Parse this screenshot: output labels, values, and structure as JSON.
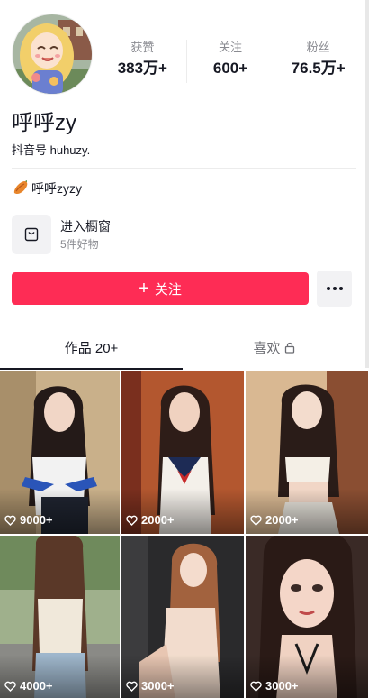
{
  "profile": {
    "nickname": "呼呼zy",
    "douyin_id": "抖音号 huhuzy.",
    "signature": "呼呼zyzy"
  },
  "stats": [
    {
      "label": "获赞",
      "value": "383万+"
    },
    {
      "label": "关注",
      "value": "600+"
    },
    {
      "label": "粉丝",
      "value": "76.5万+"
    }
  ],
  "shop": {
    "title": "进入橱窗",
    "subtitle": "5件好物"
  },
  "actions": {
    "follow_label": "关注"
  },
  "tabs": [
    {
      "label": "作品 20+",
      "active": true
    },
    {
      "label": "喜欢",
      "active": false,
      "icon": "lock-icon"
    }
  ],
  "videos": [
    {
      "likes": "9000+"
    },
    {
      "likes": "2000+"
    },
    {
      "likes": "2000+"
    },
    {
      "likes": "4000+"
    },
    {
      "likes": "3000+"
    },
    {
      "likes": "3000+"
    }
  ],
  "colors": {
    "accent": "#fe2c55",
    "text_primary": "#161823",
    "text_secondary": "#8a8b91"
  }
}
